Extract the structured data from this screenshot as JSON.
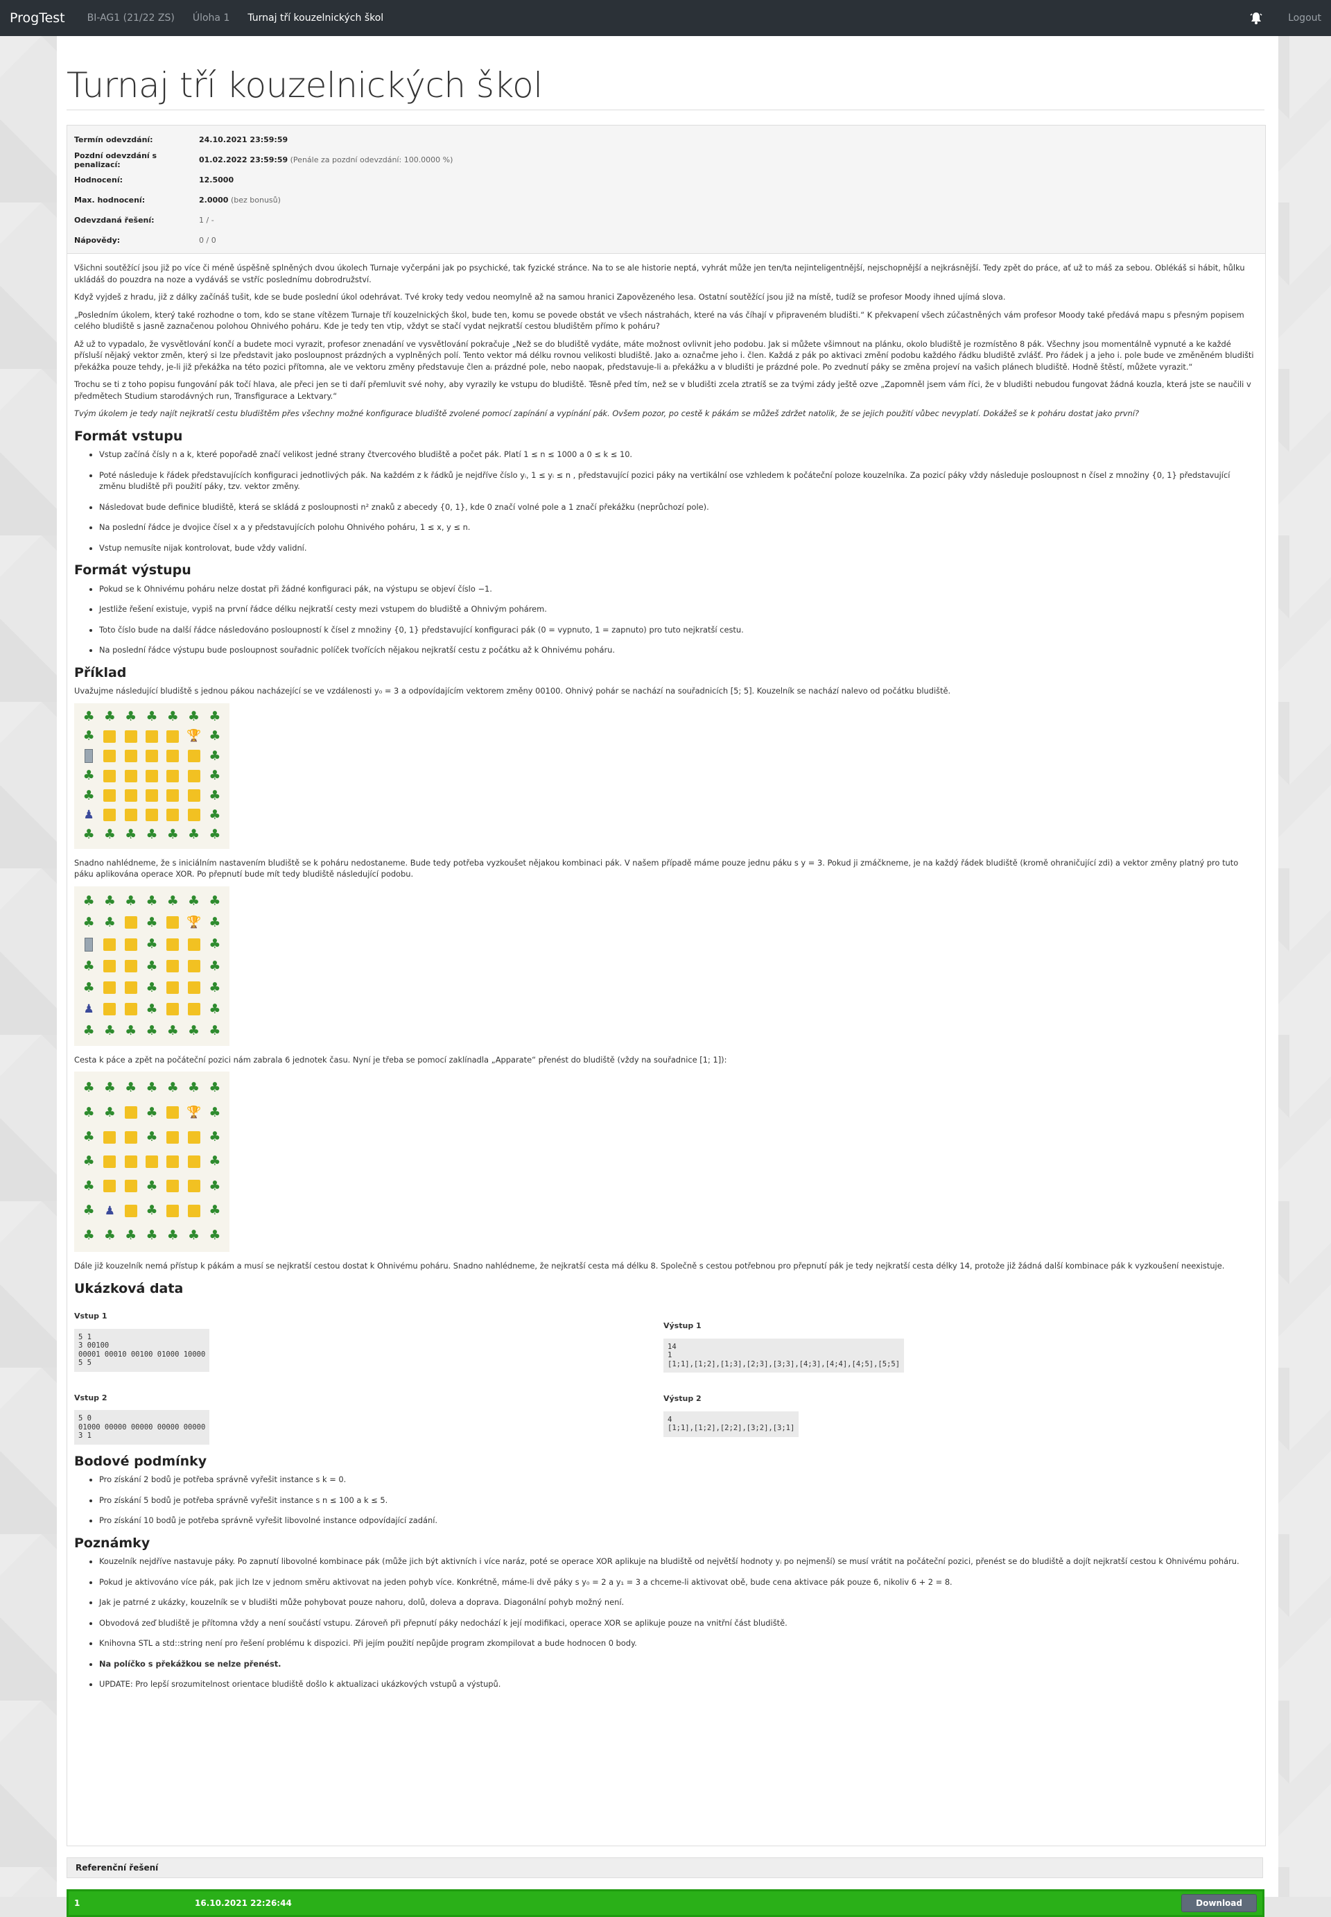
{
  "nav": {
    "brand": "ProgTest",
    "links": [
      "BI-AG1 (21/22 ZS)",
      "Úloha 1",
      "Turnaj tří kouzelnických škol"
    ],
    "logout": "Logout",
    "bell_icon": "bell-icon"
  },
  "page": {
    "title": "Turnaj tří kouzelnických škol"
  },
  "info": {
    "rows": [
      {
        "label": "Termín odevzdání:",
        "value": "24.10.2021 23:59:59",
        "extra": ""
      },
      {
        "label": "Pozdní odevzdání s penalizací:",
        "value": "01.02.2022 23:59:59",
        "extra": " (Penále za pozdní odevzdání: 100.0000 %)"
      },
      {
        "label": "Hodnocení:",
        "value": "12.5000",
        "extra": ""
      },
      {
        "label": "Max. hodnocení:",
        "value": "2.0000",
        "extra": " (bez bonusů)"
      },
      {
        "label": "Odevzdaná řešení:",
        "value": "",
        "extra": "1 / -"
      },
      {
        "label": "Nápovědy:",
        "value": "",
        "extra": "0 / 0"
      }
    ]
  },
  "intro": {
    "p1": "Všichni soutěžící jsou již po více či méně úspěšně splněných dvou úkolech Turnaje vyčerpáni jak po psychické, tak fyzické stránce. Na to se ale historie neptá, vyhrát může jen ten/ta nejinteligentnější, nejschopnější a nejkrásnější. Tedy zpět do práce, ať už to máš za sebou. Oblékáš si hábit, hůlku ukládáš do pouzdra na noze a vydáváš se vstříc poslednímu dobrodružství.",
    "p2": "Když vyjdeš z hradu, již z dálky začínáš tušit, kde se bude poslední úkol odehrávat. Tvé kroky tedy vedou neomylně až na samou hranici Zapovězeného lesa. Ostatní soutěžící jsou již na místě, tudíž se profesor Moody ihned ujímá slova.",
    "p3": "„Posledním úkolem, který také rozhodne o tom, kdo se stane vítězem Turnaje tří kouzelnických škol, bude ten, komu se povede obstát ve všech nástrahách, které na vás číhají v připraveném bludišti.“ K překvapení všech zúčastněných vám profesor Moody také předává mapu s přesným popisem celého bludiště s jasně zaznačenou polohou Ohnivého poháru. Kde je tedy ten vtip, vždyt se stačí vydat nejkratší cestou bludištěm přímo k poháru?",
    "p4": "Až už to vypadalo, že vysvětlování končí a budete moci vyrazit, profesor znenadání ve vysvětlování pokračuje „Než se do bludiště vydáte, máte možnost ovlivnit jeho podobu. Jak si můžete všimnout na plánku, okolo bludiště je rozmístěno 8 pák. Všechny jsou momentálně vypnuté a ke každé přísluší nějaký vektor změn, který si lze představit jako posloupnost prázdných a vyplněných polí. Tento vektor má délku rovnou velikosti bludiště. Jako aᵢ označme jeho i. člen. Každá z pák po aktivaci změní podobu každého řádku bludiště zvlášť. Pro řádek j a jeho i. pole bude ve změněném bludišti překážka pouze tehdy, je-li již překážka na této pozici přítomna, ale ve vektoru změny představuje člen aᵢ prázdné pole, nebo naopak, představuje-li aᵢ překážku a v bludišti je prázdné pole. Po zvednutí páky se změna projeví na vašich plánech bludiště. Hodně štěstí, můžete vyrazit.“",
    "p5": "Trochu se ti z toho popisu fungování pák točí hlava, ale přeci jen se ti daří přemluvit své nohy, aby vyrazily ke vstupu do bludiště. Těsně před tím, než se v bludišti zcela ztratíš se za tvými zády ještě ozve „Zapomněl jsem vám říci, že v bludišti nebudou fungovat žádná kouzla, která jste se naučili v předmětech Studium starodávných run, Transfigurace a Lektvary.“",
    "p6": "Tvým úkolem je tedy najít nejkratší cestu bludištěm přes všechny možné konfigurace bludiště zvolené pomocí zapínání a vypínání pák. Ovšem pozor, po cestě k pákám se můžeš zdržet natolik, že se jejich použití vůbec nevyplatí. Dokážeš se k poháru dostat jako první?"
  },
  "input_format": {
    "heading": "Formát vstupu",
    "items": [
      "Vstup začíná čísly n a k, které popořadě značí velikost jedné strany čtvercového bludiště a počet pák. Platí 1 ≤ n ≤ 1000 a 0 ≤ k ≤ 10.",
      "Poté následuje k řádek představujících konfiguraci jednotlivých pák. Na každém z k řádků je nejdříve číslo yᵢ, 1 ≤ yᵢ ≤ n , představující pozici páky na vertikální ose vzhledem k počáteční poloze kouzelníka. Za pozicí páky vždy následuje posloupnost n čísel z množiny {0, 1} představující změnu bludiště při použití páky, tzv. vektor změny.",
      "Následovat bude definice bludiště, která se skládá z posloupnosti n² znaků z abecedy {0, 1}, kde 0 značí volné pole a 1 značí překážku (neprůchozí pole).",
      "Na poslední řádce je dvojice čísel x a y představujících polohu Ohnivého poháru, 1 ≤ x, y ≤ n.",
      "Vstup nemusíte nijak kontrolovat, bude vždy validní."
    ]
  },
  "output_format": {
    "heading": "Formát výstupu",
    "items": [
      "Pokud se k Ohnivému poháru nelze dostat při žádné konfiguraci pák, na výstupu se objeví číslo −1.",
      "Jestliže řešení existuje, vypiš na první řádce délku nejkratší cesty mezi vstupem do bludiště a Ohnivým pohárem.",
      "Toto číslo bude na další řádce následováno posloupností k čísel z množiny {0, 1} představující konfiguraci pák (0 = vypnuto, 1 = zapnuto) pro tuto nejkratší cestu.",
      "Na poslední řádce výstupu bude posloupnost souřadnic políček tvořících nějakou nejkratší cestu z počátku až k Ohnivému poháru."
    ]
  },
  "example": {
    "heading": "Příklad",
    "p1": "Uvažujme následující bludiště s jednou pákou nacházející se ve vzdálenosti y₀ = 3 a odpovídajícím vektorem změny 00100. Ohnivý pohár se nachází na souřadnicích [5; 5]. Kouzelník se nachází nalevo od počátku bludiště.",
    "p2": "Snadno nahlédneme, že s iniciálním nastavením bludiště se k poháru nedostaneme. Bude tedy potřeba vyzkoušet nějakou kombinaci pák. V našem případě máme pouze jednu páku s y = 3. Pokud ji zmáčkneme, je na každý řádek bludiště (kromě ohraničující zdi) a vektor změny platný pro tuto páku aplikována operace XOR. Po přepnutí bude mít tedy bludiště následující podobu.",
    "p3": "Cesta k páce a zpět na počáteční pozici nám zabrala 6 jednotek času. Nyní je třeba se pomocí zaklínadla „Apparate“ přenést do bludiště (vždy na souřadnice [1; 1]):",
    "p4": "Dále již kouzelník nemá přístup k pákám a musí se nejkratší cestou dostat k Ohnivému poháru. Snadno nahlédneme, že nejkratší cesta má délku 8. Společně s cestou potřebnou pro přepnutí pák je tedy nejkratší cesta délky 14, protože již žádná další kombinace pák k vyzkoušení neexistuje.",
    "grids": [
      [
        "TTTTTTT",
        "TSSSSWT",
        "DSSSSST",
        "TSSSSST",
        "TSSSSST",
        "ZSSSSST",
        "TTTTTTT"
      ],
      [
        "TTTTTTT",
        "TTSTSWT",
        "DSSTSST",
        "TSSTSST",
        "TSSTSST",
        "ZSSTSST",
        "TTTTTTT"
      ],
      [
        "TTTTTTT",
        "TTSTSWT",
        "TSSTSST",
        "TSSSSST",
        "TSSTSST",
        "TZSTSST",
        "TTTTTTT"
      ]
    ]
  },
  "samples": {
    "heading": "Ukázková data",
    "in1_label": "Vstup 1",
    "in1": "5 1\n3 00100\n00001 00010 00100 01000 10000\n5 5",
    "out1_label": "Výstup 1",
    "out1": "14\n1\n[1;1],[1;2],[1;3],[2;3],[3;3],[4;3],[4;4],[4;5],[5;5]",
    "in2_label": "Vstup 2",
    "in2": "5 0\n01000 00000 00000 00000 00000\n3 1",
    "out2_label": "Výstup 2",
    "out2": "4\n[1;1],[1;2],[2;2],[3;2],[3;1]"
  },
  "points": {
    "heading": "Bodové podmínky",
    "items": [
      "Pro získání 2 bodů je potřeba správně vyřešit instance s k = 0.",
      "Pro získání 5 bodů je potřeba správně vyřešit instance s n ≤ 100 a k ≤ 5.",
      "Pro získání 10 bodů je potřeba správně vyřešit libovolné instance odpovídající zadání."
    ]
  },
  "notes": {
    "heading": "Poznámky",
    "items": [
      "Kouzelník nejdříve nastavuje páky. Po zapnutí libovolné kombinace pák (může jich být aktivních i více naráz, poté se operace XOR aplikuje na bludiště od největší hodnoty yᵢ po nejmenší) se musí vrátit na počáteční pozici, přenést se do bludiště a dojít nejkratší cestou k Ohnivému poháru.",
      "Pokud je aktivováno více pák, pak jich lze v jednom směru aktivovat na jeden pohyb více. Konkrétně, máme-li dvě páky s y₀ = 2 a y₁ = 3 a chceme-li aktivovat obě, bude cena aktivace pák pouze 6, nikoliv 6 + 2 = 8.",
      "Jak je patrné z ukázky, kouzelník se v bludišti může pohybovat pouze nahoru, dolů, doleva a doprava. Diagonální pohyb možný není.",
      "Obvodová zeď bludiště je přítomna vždy a není součástí vstupu. Zároveň při přepnutí páky nedochází k její modifikaci, operace XOR se aplikuje pouze na vnitřní část bludiště.",
      "Knihovna STL a std::string není pro řešení problému k dispozici. Při jejím použití nepůjde program zkompilovat a bude hodnocen 0 body.",
      "Na políčko s překážkou se nelze přenést.",
      "UPDATE: Pro lepší srozumitelnost orientace bludiště došlo k aktualizaci ukázkových vstupů a výstupů."
    ]
  },
  "reference": {
    "heading": "Referenční řešení",
    "row_num": "1",
    "row_date": "16.10.2021 22:26:44",
    "download": "Download",
    "status_color": "#2ab018"
  }
}
